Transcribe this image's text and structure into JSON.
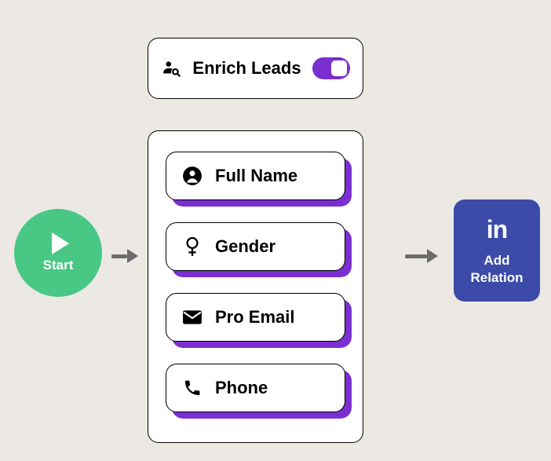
{
  "header": {
    "title": "Enrich Leads",
    "toggle_on": true
  },
  "start": {
    "label": "Start"
  },
  "fields": [
    {
      "icon": "person",
      "label": "Full Name"
    },
    {
      "icon": "gender",
      "label": "Gender"
    },
    {
      "icon": "email",
      "label": "Pro Email"
    },
    {
      "icon": "phone",
      "label": "Phone"
    }
  ],
  "addRelation": {
    "line1": "Add",
    "line2": "Relation",
    "network": "in"
  },
  "colors": {
    "accent_purple": "#7a2fd1",
    "start_green": "#48c884",
    "linkedin_blue": "#3c4ba8",
    "background": "#ece9e4"
  }
}
